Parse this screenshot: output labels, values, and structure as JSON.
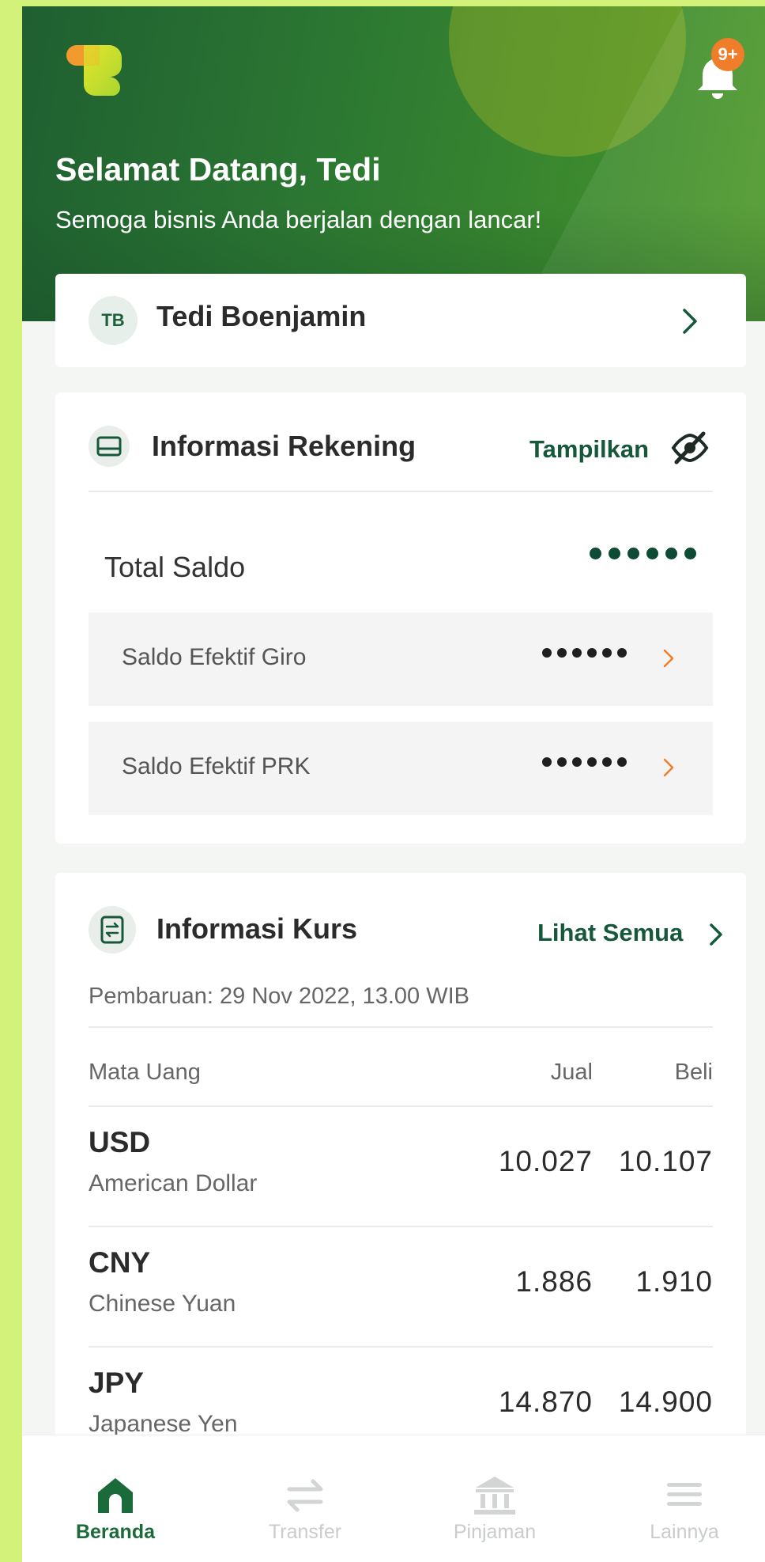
{
  "colors": {
    "brand_green": "#16583a",
    "accent_orange": "#ef7d2a",
    "background_lime": "#d3f27a"
  },
  "header": {
    "notification_badge": "9+",
    "welcome_title": "Selamat Datang, Tedi",
    "welcome_subtitle": "Semoga bisnis Anda berjalan dengan lancar!",
    "icons": [
      "logo",
      "bell-icon"
    ]
  },
  "profile": {
    "initials": "TB",
    "name": "Tedi Boenjamin"
  },
  "account_info": {
    "title": "Informasi Rekening",
    "show_label": "Tampilkan",
    "total_label": "Total Saldo",
    "rows": [
      {
        "label": "Saldo Efektif Giro"
      },
      {
        "label": "Saldo Efektif PRK"
      }
    ]
  },
  "exchange": {
    "title": "Informasi Kurs",
    "see_all_label": "Lihat Semua",
    "updated": "Pembaruan: 29 Nov 2022, 13.00 WIB",
    "columns": {
      "currency": "Mata Uang",
      "sell": "Jual",
      "buy": "Beli"
    },
    "rates": [
      {
        "code": "USD",
        "name": "American Dollar",
        "sell": "10.027",
        "buy": "10.107"
      },
      {
        "code": "CNY",
        "name": "Chinese Yuan",
        "sell": "1.886",
        "buy": "1.910"
      },
      {
        "code": "JPY",
        "name": "Japanese Yen",
        "sell": "14.870",
        "buy": "14.900"
      }
    ]
  },
  "bottom_nav": [
    {
      "label": "Beranda",
      "icon": "home-icon",
      "active": true
    },
    {
      "label": "Transfer",
      "icon": "transfer-icon",
      "active": false
    },
    {
      "label": "Pinjaman",
      "icon": "bank-icon",
      "active": false
    },
    {
      "label": "Lainnya",
      "icon": "menu-icon",
      "active": false
    }
  ]
}
